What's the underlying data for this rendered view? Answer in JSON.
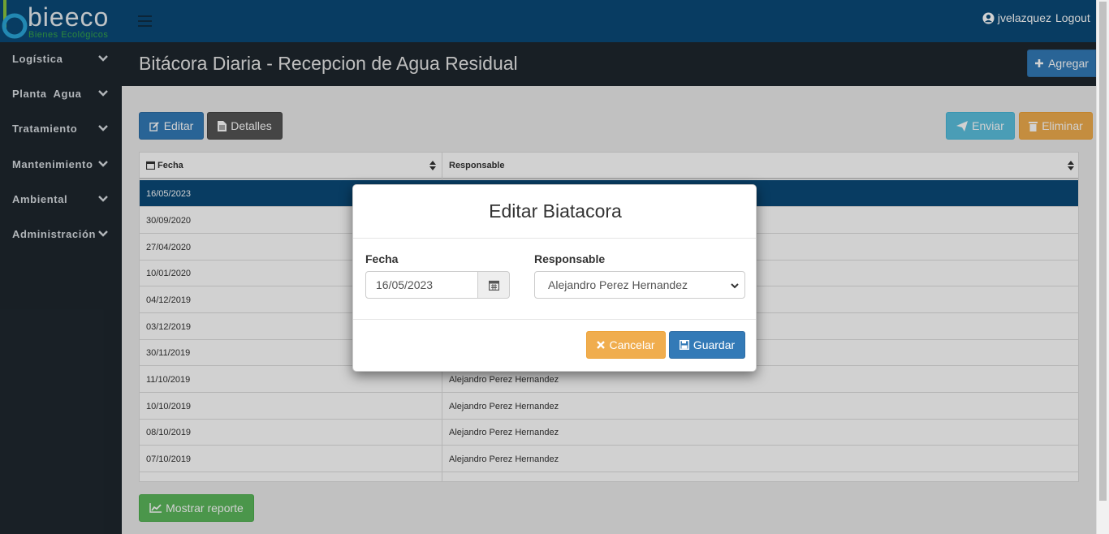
{
  "brand": {
    "name": "bieeco",
    "tagline": "Bienes Ecológicos"
  },
  "header": {
    "username": "jvelazquez",
    "logout_label": "Logout"
  },
  "sidebar": {
    "items": [
      {
        "label": "Logística"
      },
      {
        "label": "Planta  Agua"
      },
      {
        "label": "Tratamiento"
      },
      {
        "label": "Mantenimiento"
      },
      {
        "label": "Ambiental"
      },
      {
        "label": "Administración"
      }
    ]
  },
  "page": {
    "title": "Bitácora Diaria - Recepcion de Agua Residual",
    "add_label": "Agregar",
    "edit_label": "Editar",
    "details_label": "Detalles",
    "send_label": "Enviar",
    "delete_label": "Eliminar",
    "report_label": "Mostrar reporte"
  },
  "table": {
    "columns": [
      "Fecha",
      "Responsable"
    ],
    "rows": [
      {
        "fecha": "16/05/2023",
        "responsable": ""
      },
      {
        "fecha": "30/09/2020",
        "responsable": ""
      },
      {
        "fecha": "27/04/2020",
        "responsable": ""
      },
      {
        "fecha": "10/01/2020",
        "responsable": ""
      },
      {
        "fecha": "04/12/2019",
        "responsable": ""
      },
      {
        "fecha": "03/12/2019",
        "responsable": ""
      },
      {
        "fecha": "30/11/2019",
        "responsable": ""
      },
      {
        "fecha": "11/10/2019",
        "responsable": "Alejandro Perez Hernandez"
      },
      {
        "fecha": "10/10/2019",
        "responsable": "Alejandro Perez Hernandez"
      },
      {
        "fecha": "08/10/2019",
        "responsable": "Alejandro Perez Hernandez"
      },
      {
        "fecha": "07/10/2019",
        "responsable": "Alejandro Perez Hernandez"
      },
      {
        "fecha": "",
        "responsable": ""
      }
    ]
  },
  "modal": {
    "title": "Editar Biatacora",
    "fecha_label": "Fecha",
    "fecha_value": "16/05/2023",
    "responsable_label": "Responsable",
    "responsable_value": "Alejandro Perez Hernandez",
    "cancel_label": "Cancelar",
    "save_label": "Guardar"
  },
  "colors": {
    "header_bg": "#0a4a78",
    "sidebar_bg": "#1e272e",
    "primary": "#337ab7",
    "warning": "#f0ad4e",
    "info": "#5bc0de",
    "success": "#5cb85c"
  }
}
